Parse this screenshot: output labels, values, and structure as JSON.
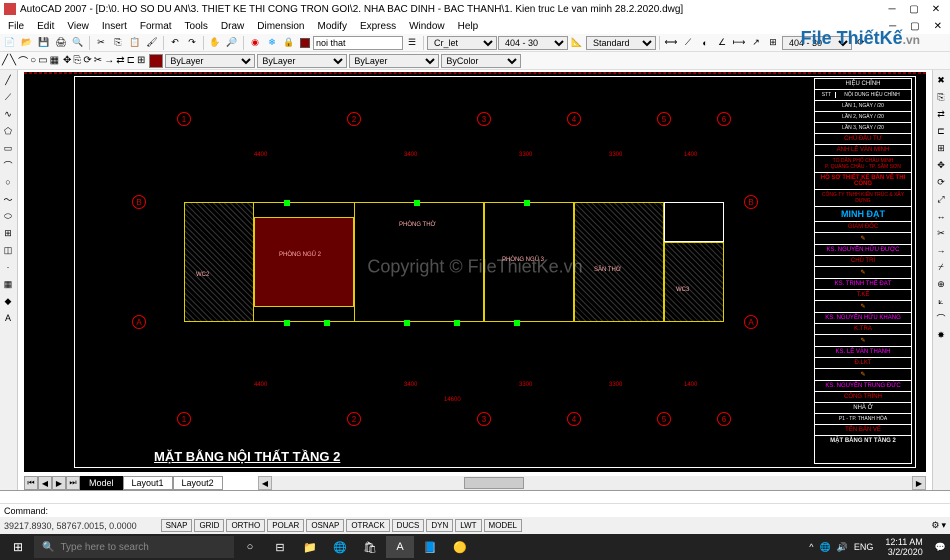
{
  "titlebar": {
    "app_name": "AutoCAD 2007",
    "doc_title": "[D:\\0. HO SO DU AN\\3. THIET KE THI CONG TRON GOI\\2. NHA BAC DINH - BAC THANH\\1. Kien truc Le van minh 28.2.2020.dwg]"
  },
  "menu": [
    "File",
    "Edit",
    "View",
    "Insert",
    "Format",
    "Tools",
    "Draw",
    "Dimension",
    "Modify",
    "Express",
    "Window",
    "Help"
  ],
  "toolbar2": {
    "layer_input": "noi that",
    "style_sel": "Cr_let",
    "dim_sel": "404 - 30",
    "standard": "Standard",
    "dim2": "404 - 30"
  },
  "prop": {
    "bylayer1": "ByLayer",
    "bylayer2": "ByLayer",
    "bycolor": "ByColor"
  },
  "tabs": {
    "model": "Model",
    "l1": "Layout1",
    "l2": "Layout2"
  },
  "cmd": {
    "prompt": "Command:",
    "history": ""
  },
  "status": {
    "coords": "39217.8930, 58767.0015, 0.0000",
    "toggles": [
      "SNAP",
      "GRID",
      "ORTHO",
      "POLAR",
      "OSNAP",
      "OTRACK",
      "DUCS",
      "DYN",
      "LWT",
      "MODEL"
    ]
  },
  "taskbar": {
    "search_placeholder": "Type here to search",
    "tray": {
      "lang": "ENG",
      "time": "12:11 AM",
      "date": "3/2/2020"
    }
  },
  "watermark": {
    "logo": "File ThiếtKế",
    "logo_suffix": ".vn",
    "center": "Copyright © FileThietKe.vn"
  },
  "drawing": {
    "title": "MẶT BẰNG NỘI THẤT TẦNG 2",
    "dims_top": [
      "4400",
      "3400",
      "3300",
      "3300",
      "1400"
    ],
    "dims_total": "14600",
    "grid_cols": [
      "1",
      "2",
      "3",
      "4",
      "5",
      "6"
    ],
    "grid_rows": [
      "A",
      "B"
    ],
    "rooms": {
      "pn2": "PHÒNG NGỦ 2",
      "pt": "PHÒNG THỜ",
      "pn3": "PHÒNG NGỦ 3",
      "st": "SÂN THỜ",
      "wc2": "WC2",
      "wc3": "WC3"
    }
  },
  "titleblock": {
    "header": "HIỆU CHỈNH",
    "cols": [
      "STT",
      "NỘI DUNG HIỆU CHỈNH"
    ],
    "rows": [
      "LẦN 1, NGÀY   /   /20",
      "LẦN 2, NGÀY   /   /20",
      "LẦN 3, NGÀY   /   /20"
    ],
    "owner_label": "CHỦ ĐẦU TƯ",
    "owner": "ANH LÊ VĂN MINH",
    "address": "TỔ DÂN PHỐ CHÂU MINH\nP. QUẢNG CHÂU - TP. SẦM SƠN",
    "project_label": "HỒ SƠ THIẾT KẾ BẢN VẼ THI CÔNG",
    "company": "CÔNG TY TNHH KIẾN TRÚC & XÂY DỰNG",
    "company2": "MINH ĐẠT",
    "director_label": "GIÁM ĐỐC",
    "director": "KS. NGUYỄN HỮU ĐƯỢC",
    "designer_label": "CHỦ TRÌ",
    "designer": "KS. TRỊNH THẾ ĐẠT",
    "tk_label": "T.KẾ",
    "tk": "KS. NGUYỄN HỮU KHANG",
    "kt_label": "K.TRA",
    "kt": "KS. LÊ VĂN THANH",
    "dlkt_label": "Đ.LKT",
    "dlkt": "KS. NGUYỄN TRUNG ĐỨC",
    "congtrinh_label": "CÔNG TRÌNH",
    "congtrinh": "NHÀ Ở",
    "diadiem": "P1 - TP. THANH HÓA",
    "tenban_label": "TÊN BẢN VẼ",
    "tenban": "MẶT BẰNG NT TẦNG 2"
  }
}
